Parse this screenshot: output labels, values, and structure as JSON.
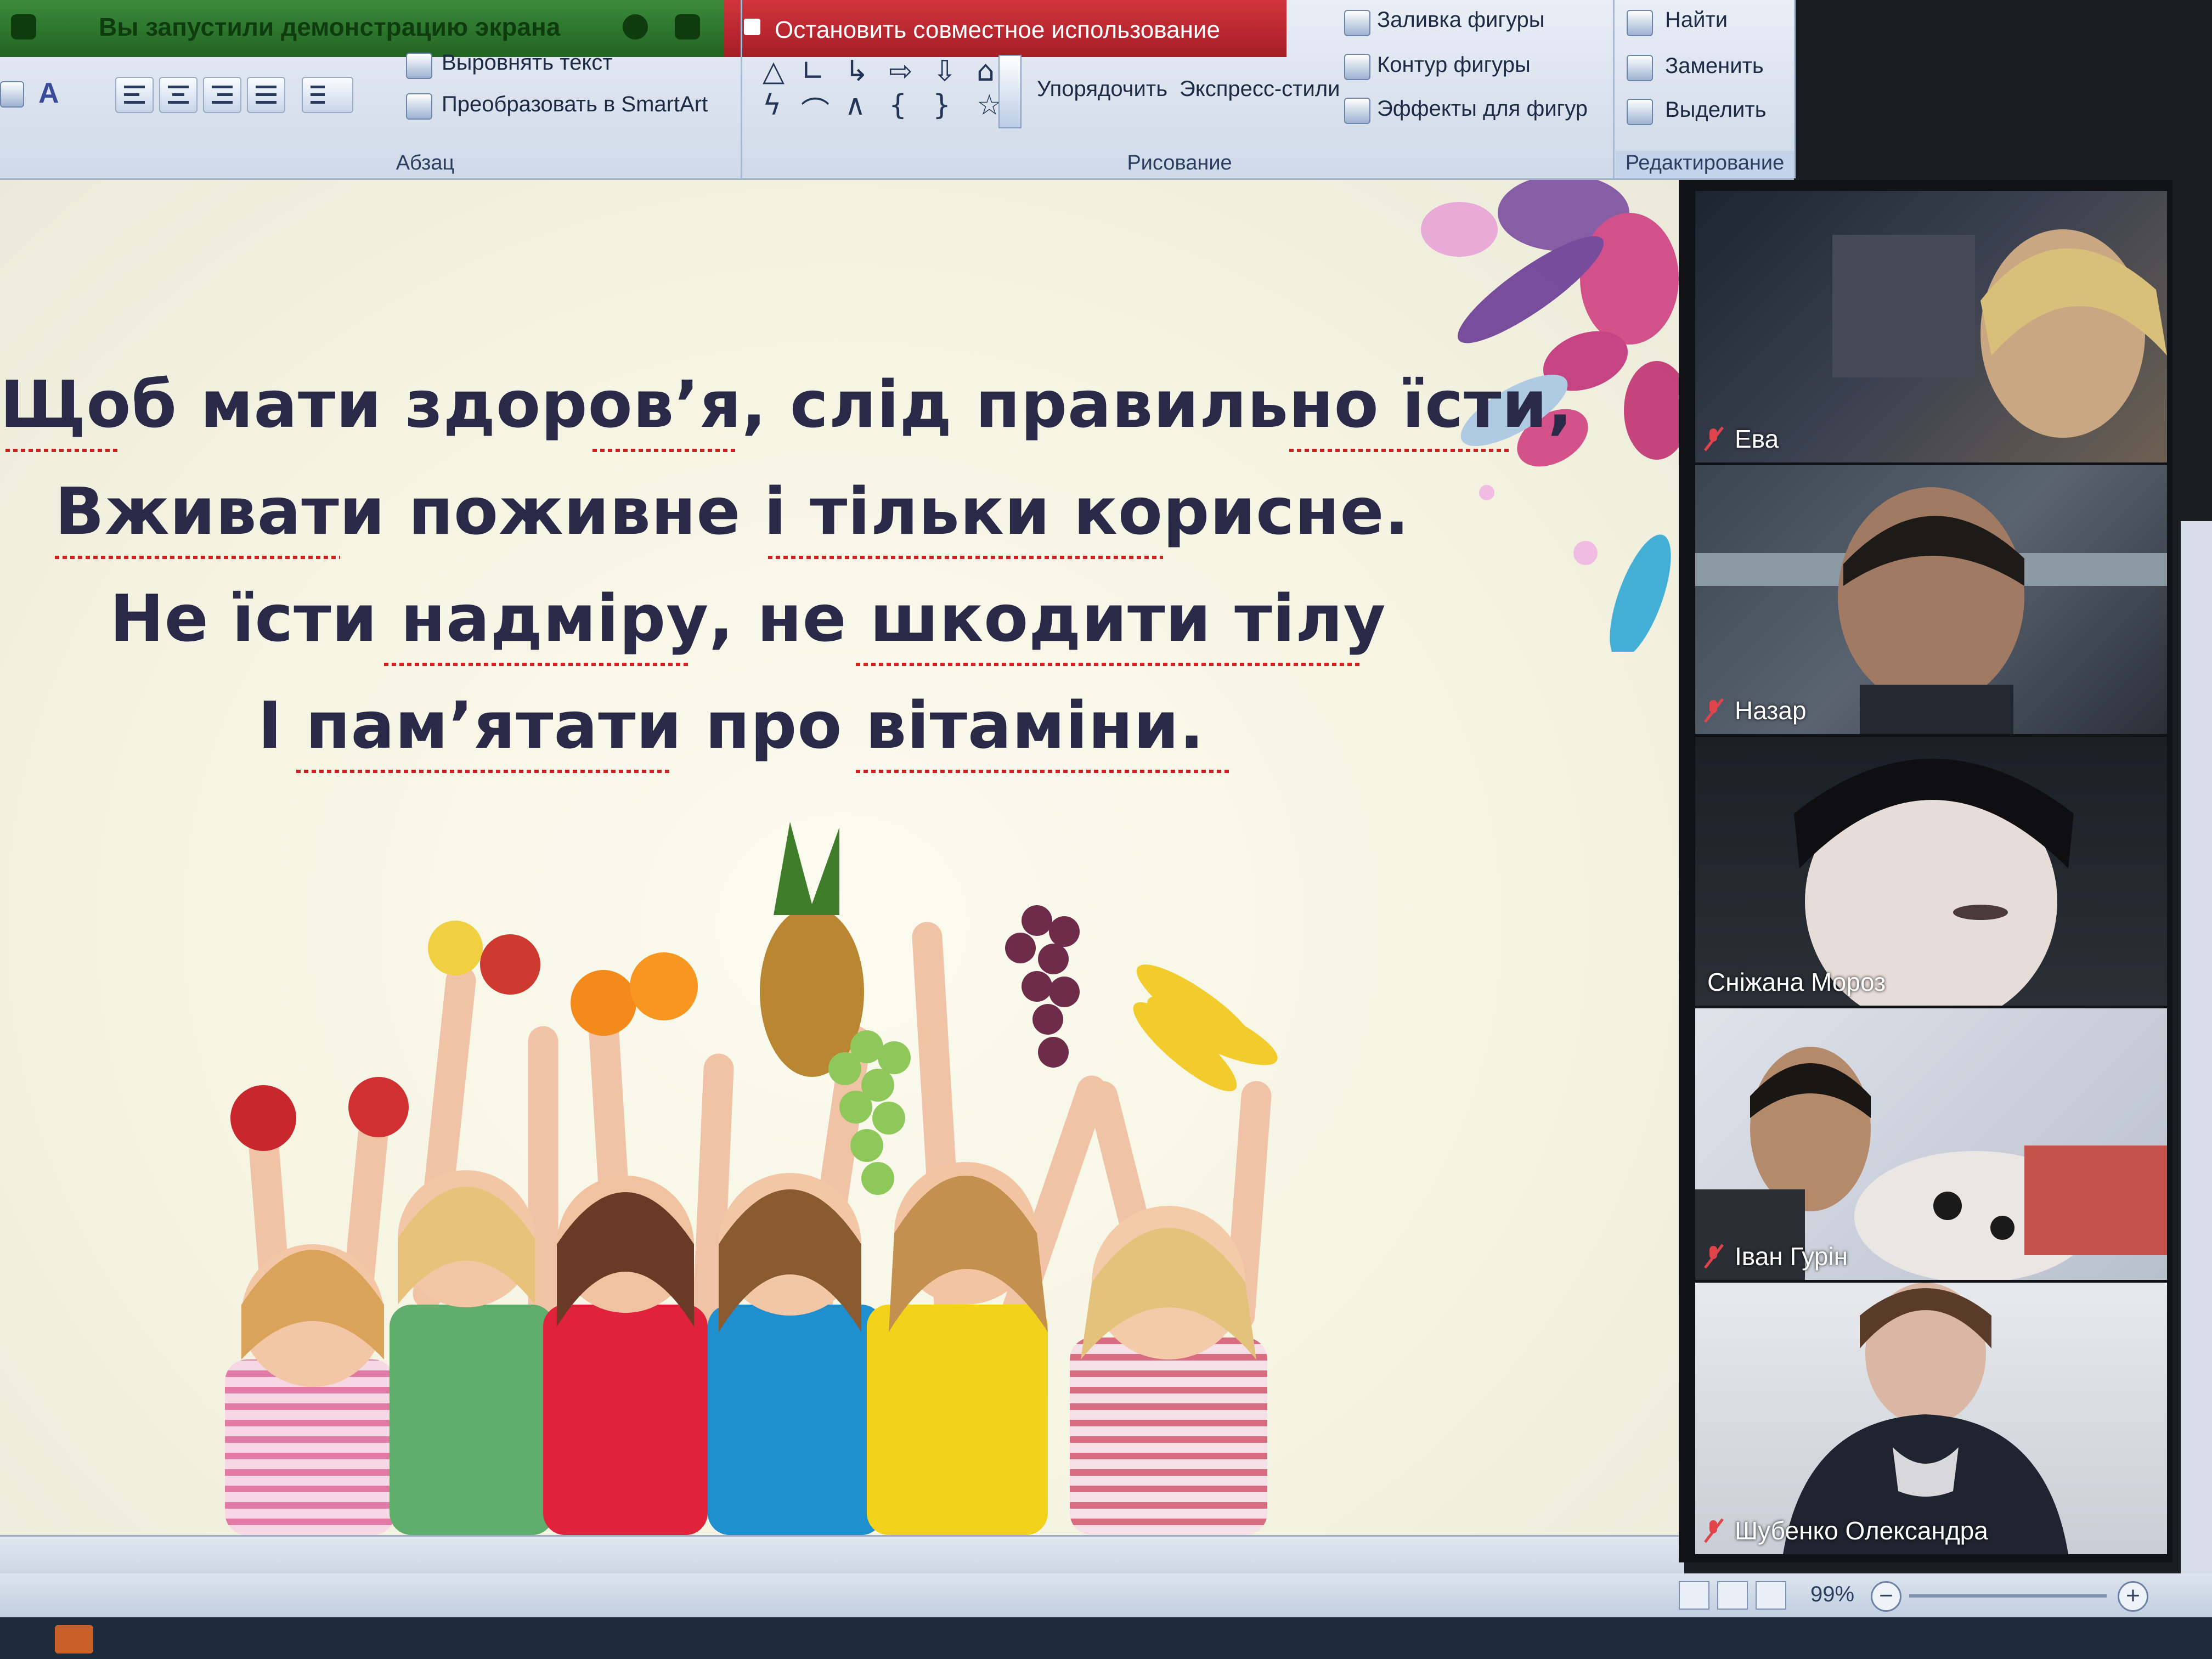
{
  "share_bar": {
    "notice": "Вы запустили демонстрацию экрана",
    "stop_label": "Остановить совместное использование"
  },
  "ribbon": {
    "paragraph": {
      "label": "Абзац",
      "align_text": "Выровнять текст",
      "smartart": "Преобразовать в SmartArt"
    },
    "drawing": {
      "label": "Рисование",
      "arrange": "Упорядочить",
      "quick_styles": "Экспресс-стили",
      "shape_fill": "Заливка фигуры",
      "shape_outline": "Контур фигуры",
      "shape_effects": "Эффекты для фигур"
    },
    "editing": {
      "label": "Редактирование",
      "find": "Найти",
      "replace": "Заменить",
      "select": "Выделить"
    }
  },
  "slide": {
    "poem": [
      "Щоб мати здоров’я, слід правильно їсти,",
      "Вживати поживне і тільки корисне.",
      "Не їсти надміру, не шкодити тілу",
      "І пам’ятати про вітаміни."
    ]
  },
  "participants": [
    {
      "name": "Ева",
      "muted": true
    },
    {
      "name": "Назар",
      "muted": true
    },
    {
      "name": "Сніжана Мороз",
      "muted": false
    },
    {
      "name": "Іван Гурін",
      "muted": true
    },
    {
      "name": "Шубенко Олександра",
      "muted": true
    }
  ],
  "status": {
    "zoom": "99%"
  },
  "colors": {
    "share_green": "#2e7a2e",
    "stop_red": "#c0262e",
    "poem_text": "#2a2a48",
    "ribbon_bg": "#dbe4f0"
  }
}
